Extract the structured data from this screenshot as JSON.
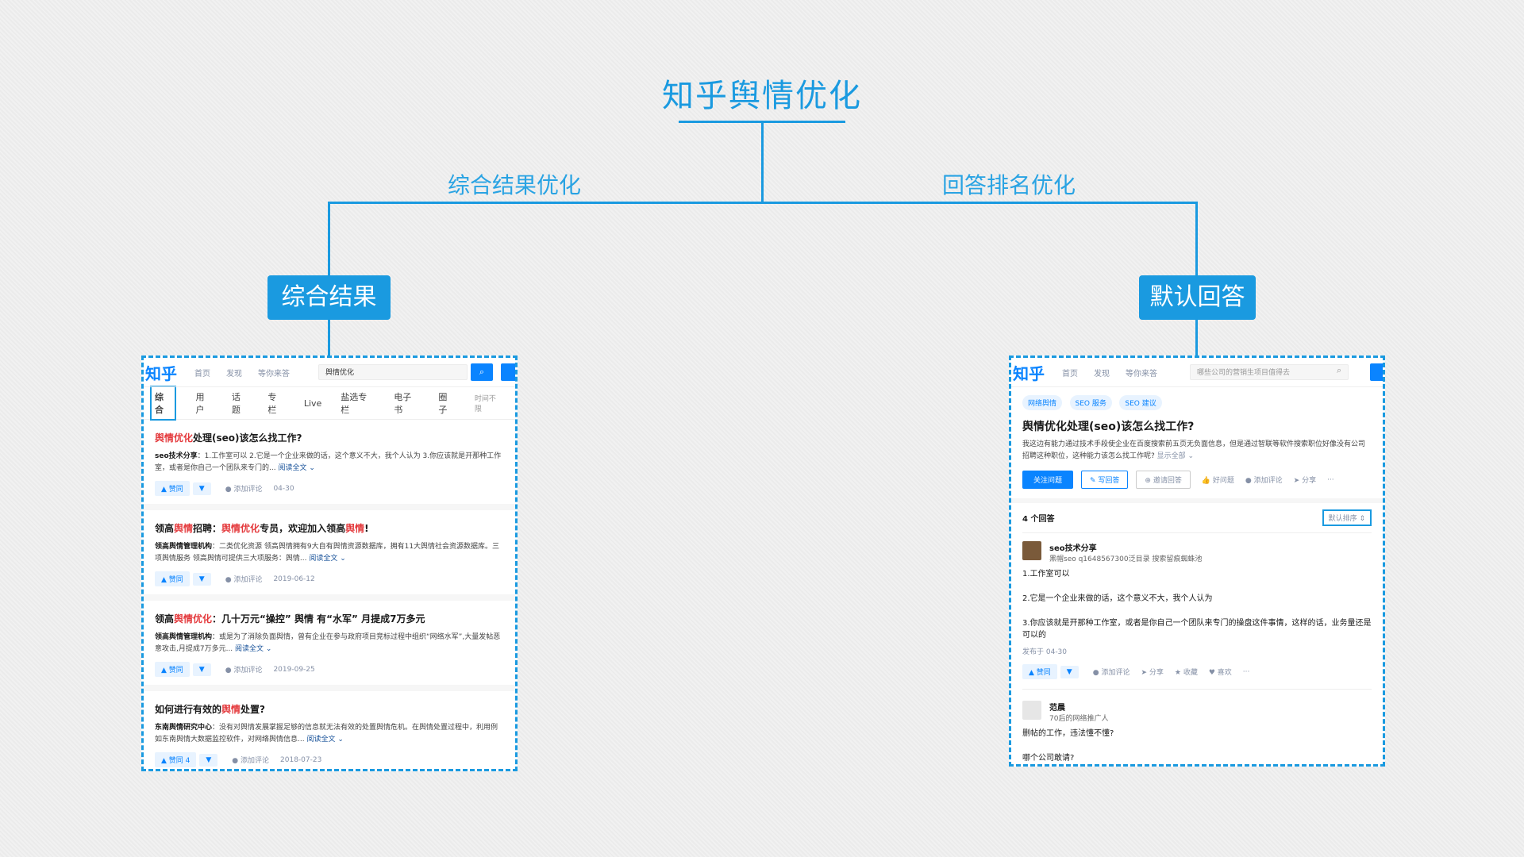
{
  "title": "知乎舆情优化",
  "branches": {
    "left_label": "综合结果优化",
    "right_label": "回答排名优化",
    "left_box": "综合结果",
    "right_box": "默认回答"
  },
  "left_panel": {
    "logo": "知乎",
    "nav": [
      "首页",
      "发现",
      "等你来答"
    ],
    "search_value": "舆情优化",
    "tabs": [
      "综合",
      "用户",
      "话题",
      "专栏",
      "Live",
      "盐选专栏",
      "电子书",
      "圈子"
    ],
    "time_filter": "时间不限",
    "results": [
      {
        "title_pre": "舆情优化",
        "title_post": "处理(seo)该怎么找工作?",
        "author": "seo技术分享",
        "text": "：1.工作室可以 2.它是一个企业来做的话，这个意义不大，我个人认为 3.你应该就是开那种工作室，或者是你自己一个团队来专门的...",
        "more": "阅读全文 ⌄",
        "vote": "▲ 赞同",
        "comment": "添加评论",
        "date": "04-30"
      },
      {
        "title_pre": "领高",
        "title_hl1": "舆情",
        "title_mid": "招聘：",
        "title_hl2": "舆情优化",
        "title_post": "专员，欢迎加入领高",
        "title_hl3": "舆情",
        "title_end": "!",
        "author": "领高舆情管理机构",
        "text": "：二类优化资源 领高舆情拥有9大自有舆情资源数据库，拥有11大舆情社会资源数据库。三项舆情服务 领高舆情可提供三大项服务：舆情...",
        "more": "阅读全文 ⌄",
        "vote": "▲ 赞同",
        "comment": "添加评论",
        "date": "2019-06-12"
      },
      {
        "title_pre": "领高",
        "title_hl1": "舆情优化",
        "title_post": "：几十万元“操控” 舆情 有“水军” 月提成7万多元",
        "author": "领高舆情管理机构",
        "text": "：或是为了消除负面舆情，曾有企业在参与政府项目竞标过程中组织“网络水军”,大量发帖恶意攻击,月提成7万多元...",
        "more": "阅读全文 ⌄",
        "vote": "▲ 赞同",
        "comment": "添加评论",
        "date": "2019-09-25"
      },
      {
        "title_pre": "如何进行有效的",
        "title_hl1": "舆情",
        "title_post": "处置?",
        "author": "东南舆情研究中心",
        "text": "：没有对舆情发展掌握足够的信息就无法有效的处置舆情危机。在舆情处置过程中，利用例如东南舆情大数据监控软件，对网络舆情信息...",
        "more": "阅读全文 ⌄",
        "vote": "▲ 赞同 4",
        "comment": "添加评论",
        "date": "2018-07-23"
      }
    ]
  },
  "right_panel": {
    "logo": "知乎",
    "nav": [
      "首页",
      "发现",
      "等你来答"
    ],
    "search_placeholder": "哪些公司的营销生项目值得去",
    "tags": [
      "网络舆情",
      "SEO 服务",
      "SEO 建议"
    ],
    "question": "舆情优化处理(seo)该怎么找工作?",
    "desc": "我这边有能力通过技术手段使企业在百度搜索前五页无负面信息，但是通过智联等软件搜索职位好像没有公司招聘这种职位，这种能力该怎么找工作呢?",
    "show_all": "显示全部 ⌄",
    "buttons": {
      "follow": "关注问题",
      "write": "✎ 写回答",
      "invite": "⊕ 邀请回答",
      "good": "好问题",
      "comment": "添加评论",
      "share": "分享",
      "more": "···"
    },
    "answer_count": "4 个回答",
    "sort": "默认排序 ⇕",
    "answer1": {
      "name": "seo技术分享",
      "sub": "黑帽seo q1648567300泛目录 搜索留痕蜘蛛池",
      "p1": "1.工作室可以",
      "p2": "2.它是一个企业来做的话，这个意义不大，我个人认为",
      "p3": "3.你应该就是开那种工作室，或者是你自己一个团队来专门的操盘这件事情，这样的话，业务量还是可以的",
      "date": "发布于 04-30",
      "vote": "▲ 赞同",
      "comment": "添加评论",
      "share": "分享",
      "collect": "收藏",
      "like": "喜欢",
      "more": "···"
    },
    "answer2": {
      "name": "范晨",
      "sub": "70后的网络推广人",
      "p1": "删帖的工作，违法懂不懂?",
      "p2": "哪个公司敢请?"
    }
  }
}
